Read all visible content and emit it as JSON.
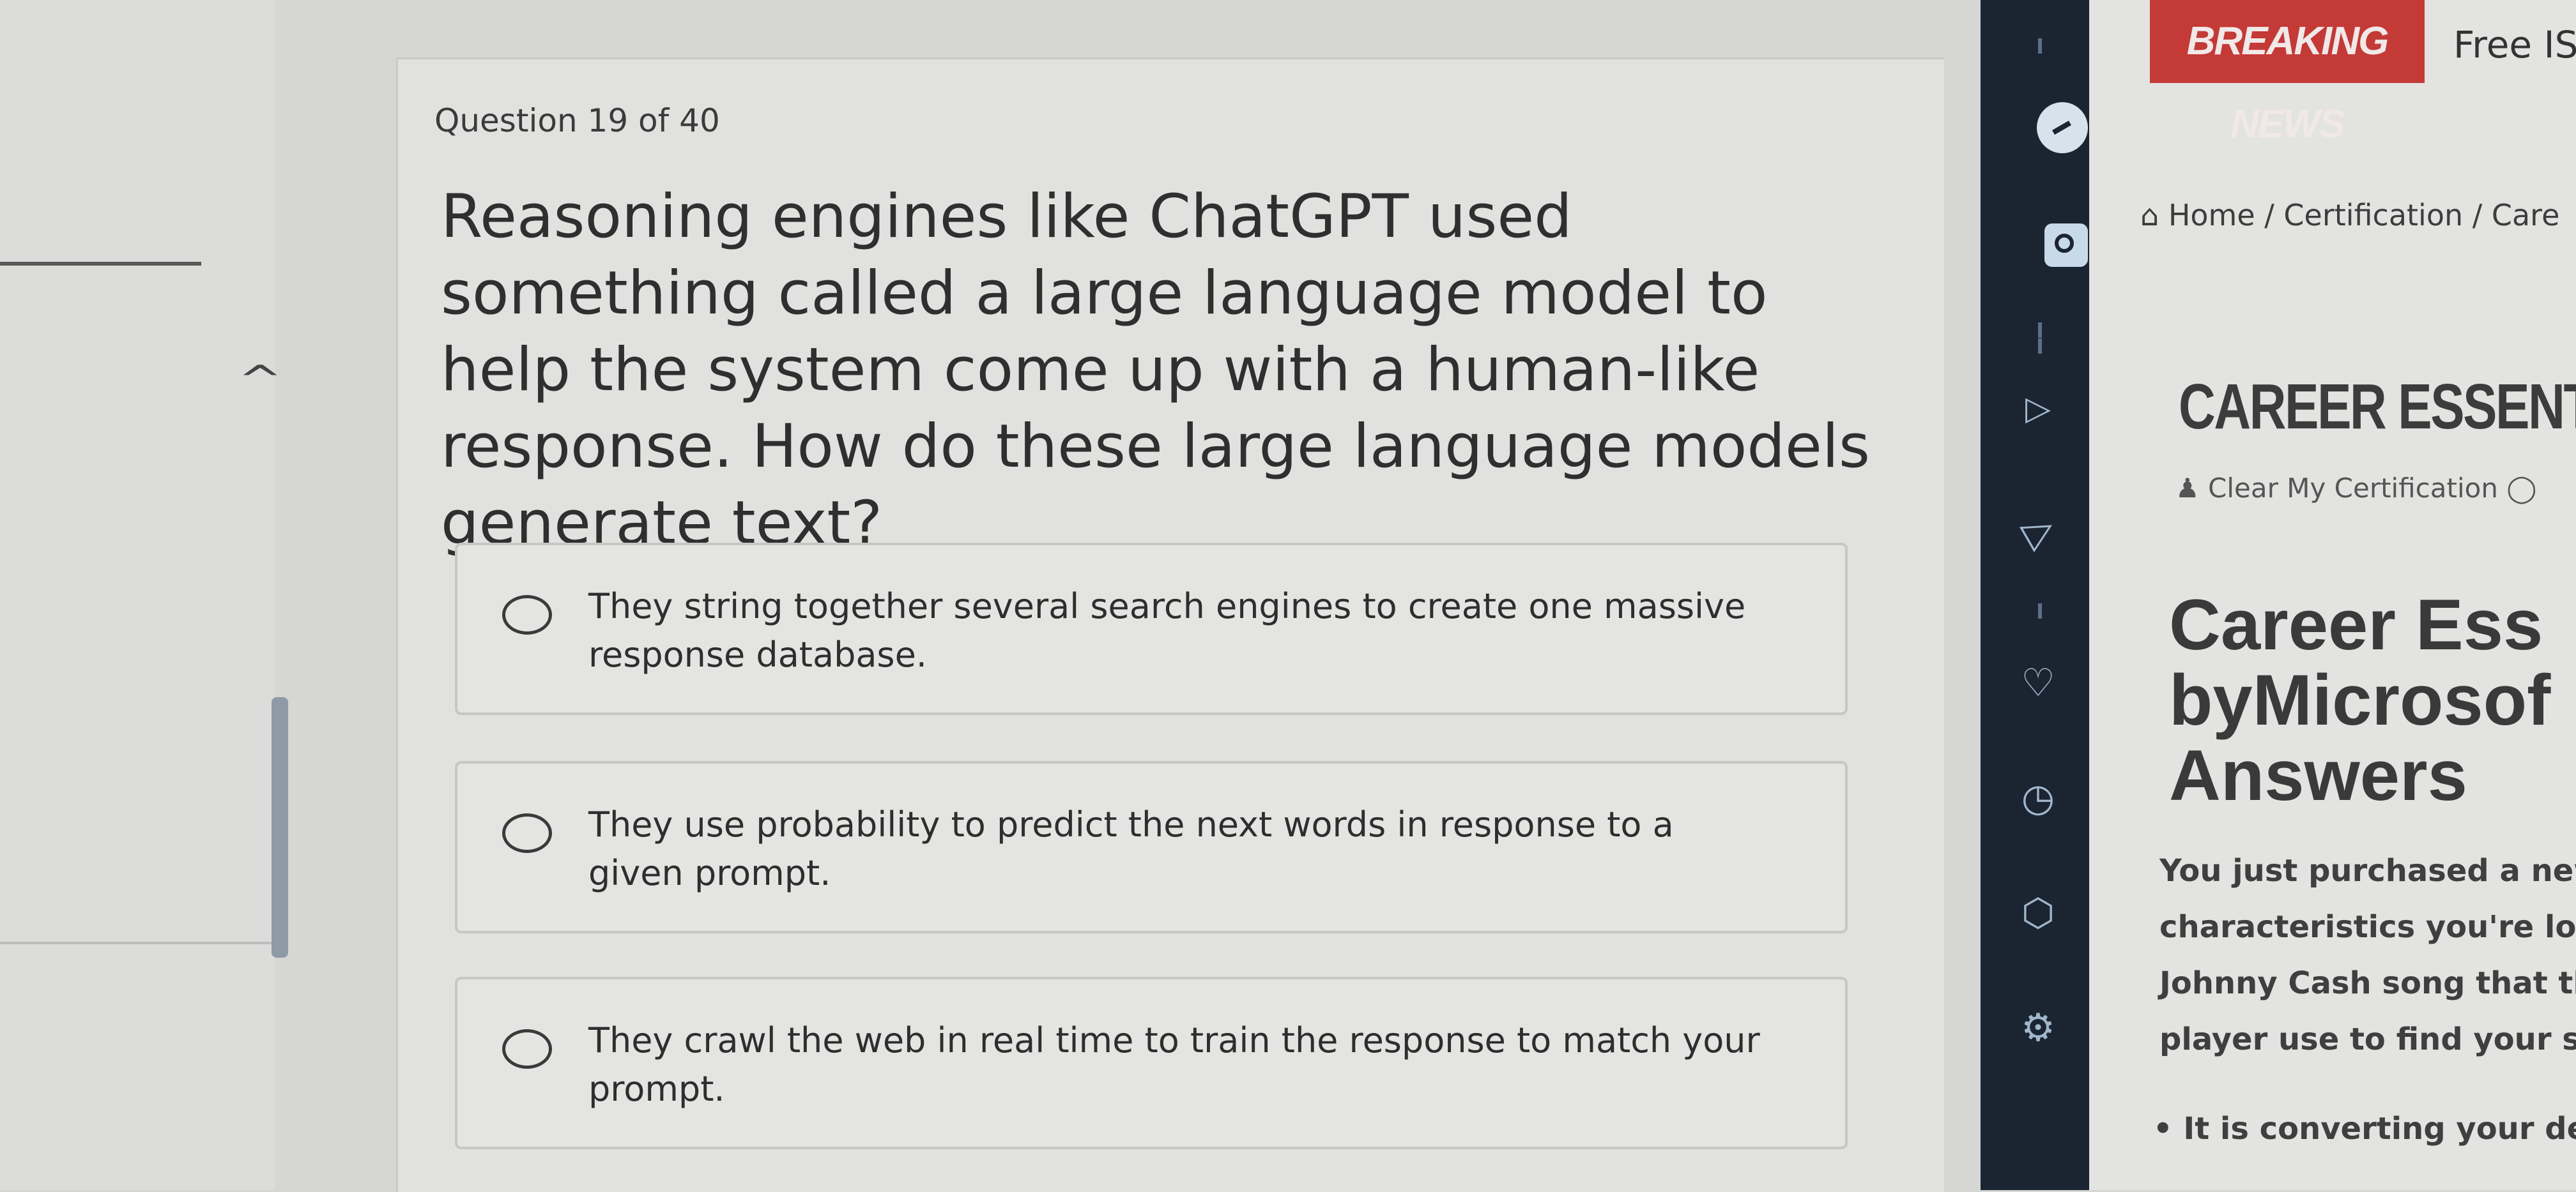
{
  "quiz": {
    "progress": "Question 19 of 40",
    "question": "Reasoning engines like ChatGPT used something called a large language model to help the system come up with a human-like response. How do these large language models generate text?",
    "options": [
      {
        "label": "They string together several search engines to create one massive response database.",
        "selected": false
      },
      {
        "label": "They use probability to predict the next words in response to a given prompt.",
        "selected": false
      },
      {
        "label": "They crawl the web in real time to train the response to match your prompt.",
        "selected": false
      }
    ]
  },
  "left_pane": {
    "collapse_icon": "chevron-up-icon"
  },
  "sidebar": {
    "icons": [
      "messenger-icon",
      "instagram-icon",
      "play-icon",
      "send-icon",
      "heart-icon",
      "clock-icon",
      "cube-icon",
      "settings-icon"
    ]
  },
  "web": {
    "breaking_label": "BREAKING NEWS",
    "ticker_text": "Free ISO",
    "breadcrumb": "Home / Certification / Care",
    "page_title": "CAREER ESSENTIAL",
    "byline": "Clear My Certification",
    "article_heading": [
      "Career Ess",
      "byMicrosof",
      "Answers"
    ],
    "body_lines": [
      "You just purchased a new s",
      "characteristics you're looki",
      "Johnny Cash song that they",
      "player use to find your song"
    ],
    "bullet": "It is converting your desc",
    "colors": {
      "breaking_bg": "#c33a37",
      "sidebar_bg": "#1b2431"
    }
  }
}
